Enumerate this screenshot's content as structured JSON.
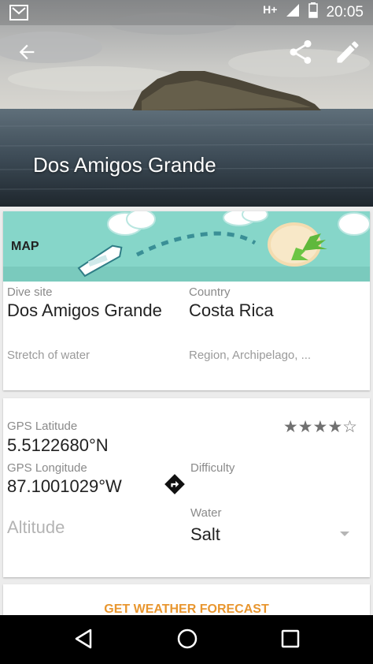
{
  "status_bar": {
    "network": "H+",
    "time": "20:05"
  },
  "header": {
    "title": "Dos Amigos Grande"
  },
  "map": {
    "label": "MAP"
  },
  "dive_info": {
    "dive_site_label": "Dive site",
    "dive_site_value": "Dos Amigos Grande",
    "country_label": "Country",
    "country_value": "Costa Rica",
    "stretch_hint": "Stretch of water",
    "region_hint": "Region, Archipelago, ..."
  },
  "gps": {
    "latitude_label": "GPS Latitude",
    "latitude_value": "5.5122680°N",
    "longitude_label": "GPS Longitude",
    "longitude_value": "87.1001029°W",
    "altitude_hint": "Altitude",
    "rating": "★★★★☆",
    "difficulty_label": "Difficulty",
    "water_label": "Water",
    "water_value": "Salt"
  },
  "weather": {
    "button_label": "GET WEATHER FORECAST"
  },
  "colors": {
    "accent": "#e8962f",
    "map_bg": "#86d6c9"
  }
}
